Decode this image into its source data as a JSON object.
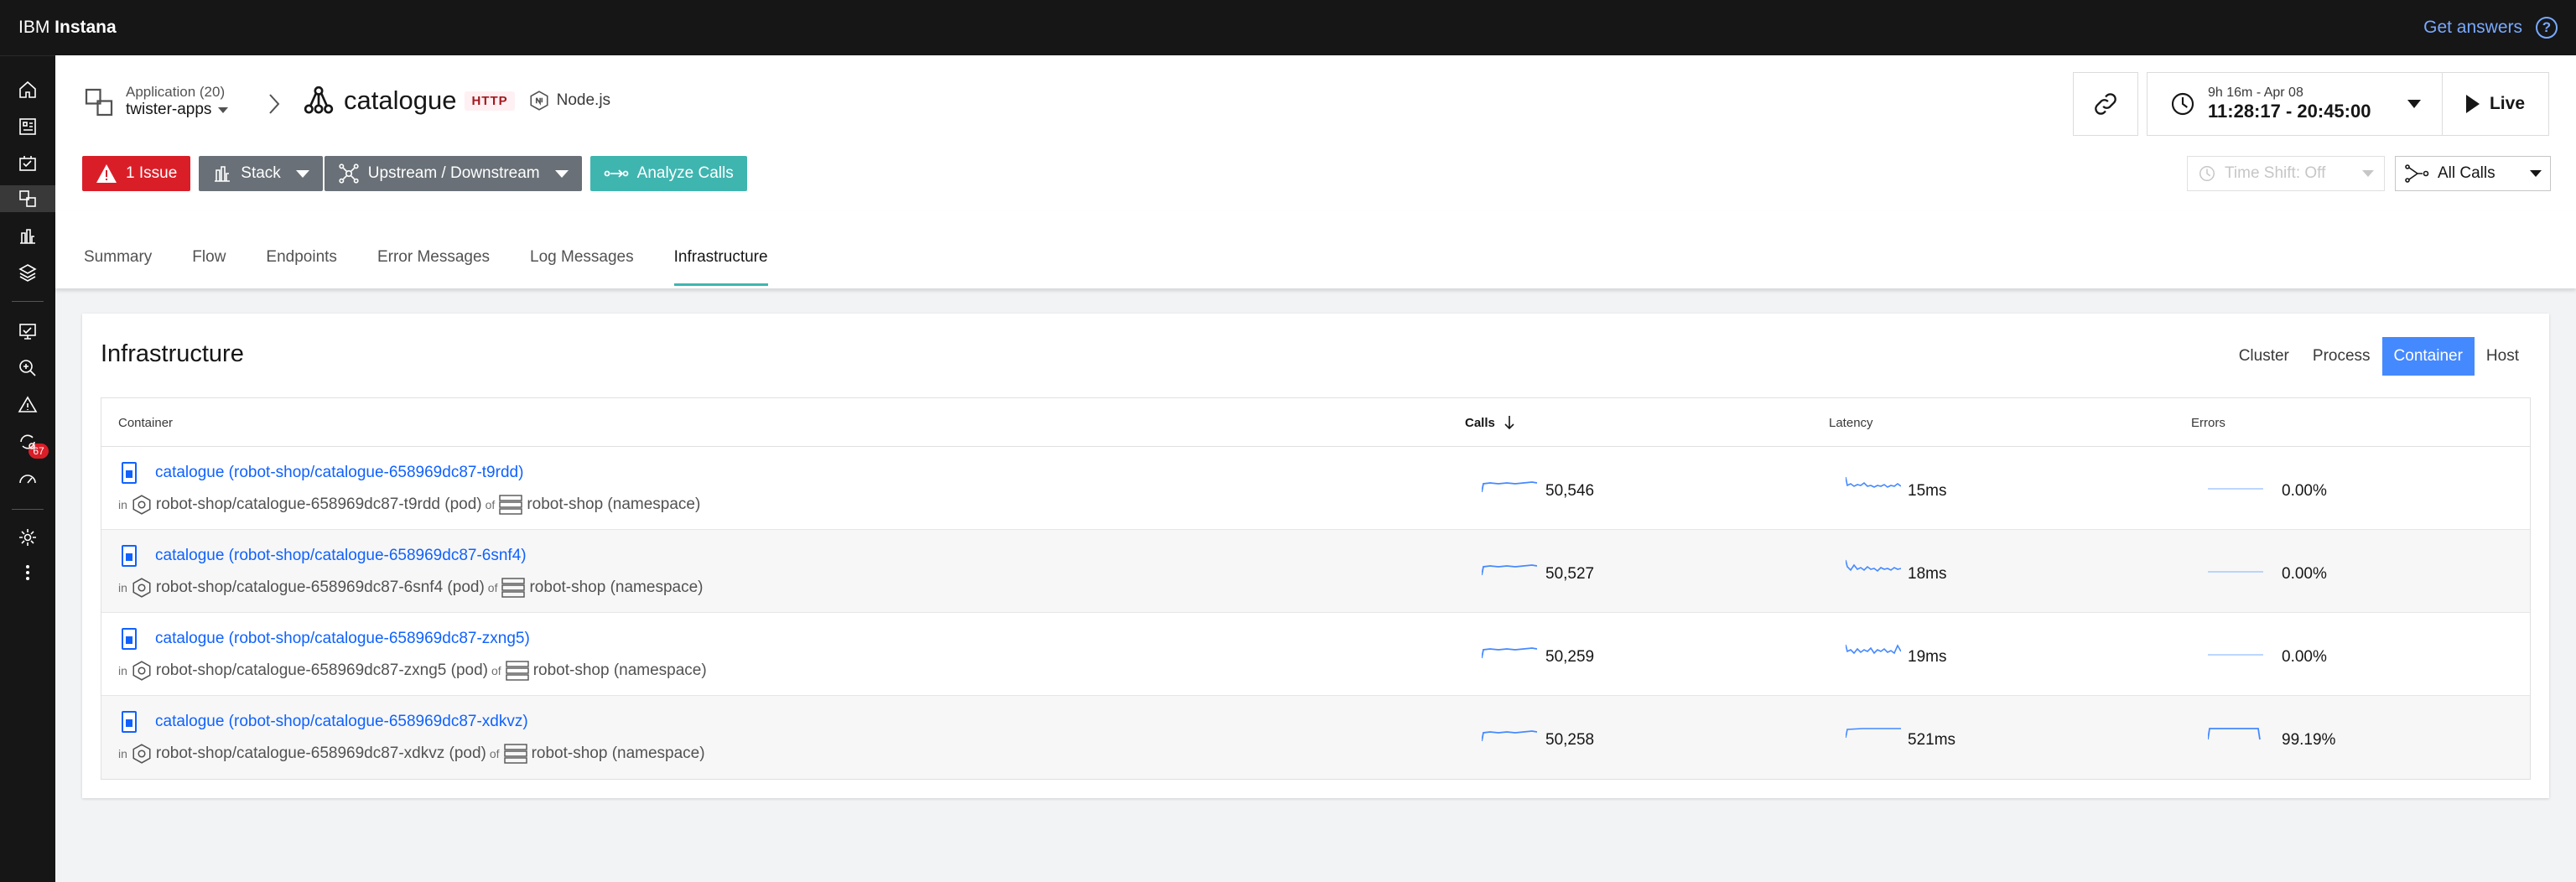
{
  "topbar": {
    "brand_prefix": "IBM ",
    "brand_name": "Instana",
    "get_answers": "Get answers",
    "help": "?"
  },
  "nav": {
    "alert_count": "67"
  },
  "header": {
    "app_label": "Application (20)",
    "app_value": "twister-apps",
    "service_name": "catalogue",
    "protocol_tag": "HTTP",
    "technology": "Node.js",
    "time_range": "9h 16m - Apr 08",
    "time_value": "11:28:17 - 20:45:00",
    "live_label": "Live"
  },
  "toolbar": {
    "issue_label": "1 Issue",
    "stack_label": "Stack",
    "updown_label": "Upstream / Downstream",
    "analyze_label": "Analyze Calls",
    "timeshift_label": "Time Shift: Off",
    "allcalls_label": "All Calls"
  },
  "tabs": [
    "Summary",
    "Flow",
    "Endpoints",
    "Error Messages",
    "Log Messages",
    "Infrastructure"
  ],
  "card": {
    "title": "Infrastructure",
    "views": [
      "Cluster",
      "Process",
      "Container",
      "Host"
    ],
    "columns": {
      "container": "Container",
      "calls": "Calls",
      "latency": "Latency",
      "errors": "Errors"
    },
    "rows": [
      {
        "name": "catalogue (robot-shop/catalogue-658969dc87-t9rdd)",
        "in": "in",
        "pod": "robot-shop/catalogue-658969dc87-t9rdd (pod)",
        "of": "of",
        "ns": "robot-shop (namespace)",
        "calls": "50,546",
        "latency": "15ms",
        "errors": "0.00%"
      },
      {
        "name": "catalogue (robot-shop/catalogue-658969dc87-6snf4)",
        "in": "in",
        "pod": "robot-shop/catalogue-658969dc87-6snf4 (pod)",
        "of": "of",
        "ns": "robot-shop (namespace)",
        "calls": "50,527",
        "latency": "18ms",
        "errors": "0.00%"
      },
      {
        "name": "catalogue (robot-shop/catalogue-658969dc87-zxng5)",
        "in": "in",
        "pod": "robot-shop/catalogue-658969dc87-zxng5 (pod)",
        "of": "of",
        "ns": "robot-shop (namespace)",
        "calls": "50,259",
        "latency": "19ms",
        "errors": "0.00%"
      },
      {
        "name": "catalogue (robot-shop/catalogue-658969dc87-xdkvz)",
        "in": "in",
        "pod": "robot-shop/catalogue-658969dc87-xdkvz (pod)",
        "of": "of",
        "ns": "robot-shop (namespace)",
        "calls": "50,258",
        "latency": "521ms",
        "errors": "99.19%"
      }
    ]
  },
  "colors": {
    "accent": "#3fb5b0",
    "link": "#0f62fe",
    "issue": "#da1e28",
    "spark": "#4589ff"
  }
}
